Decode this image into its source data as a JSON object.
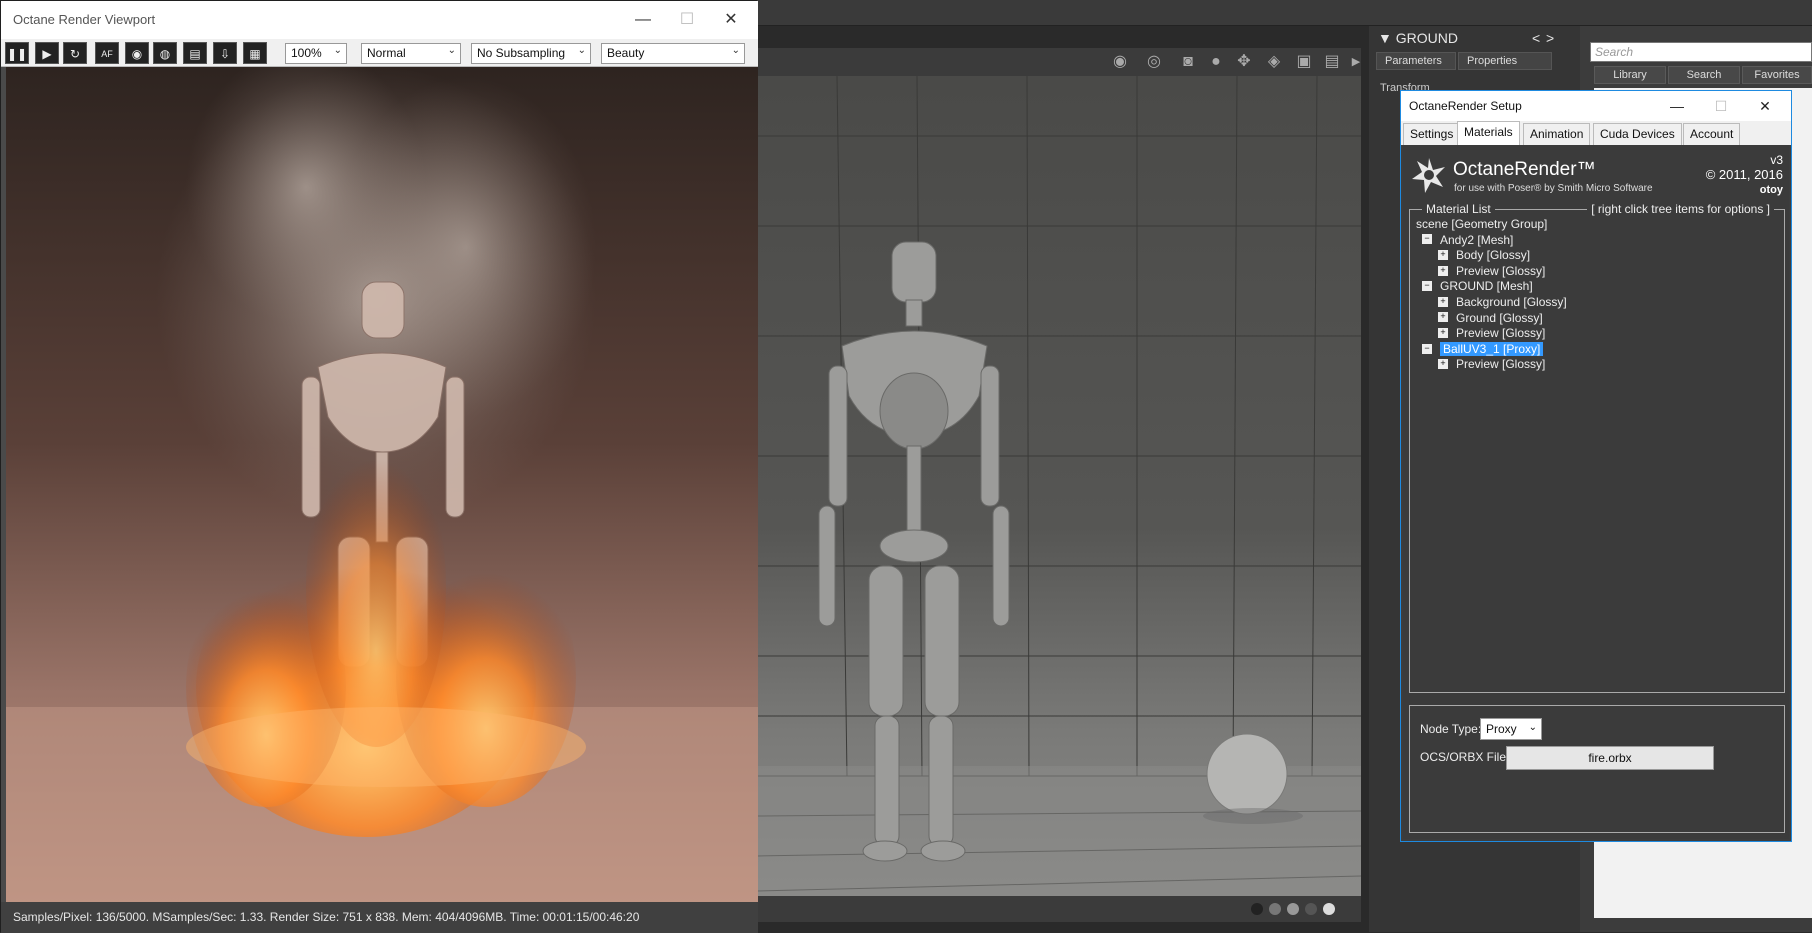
{
  "host": {
    "object_name": "GROUND",
    "tabs": [
      "Parameters",
      "Properties"
    ],
    "transform_label": "Transform",
    "search_placeholder": "Search",
    "library_tabs": [
      "Library",
      "Search",
      "Favorites"
    ]
  },
  "render_viewport": {
    "title": "Octane Render Viewport",
    "toolbar": {
      "zoom": "100%",
      "mode": "Normal",
      "subsampling": "No Subsampling",
      "pass": "Beauty"
    },
    "status": "Samples/Pixel: 136/5000. MSamples/Sec: 1.33. Render Size: 751 x 838. Mem: 404/4096MB. Time: 00:01:15/00:46:20"
  },
  "setup_dialog": {
    "title": "OctaneRender Setup",
    "tabs": [
      "Settings",
      "Materials",
      "Animation",
      "Cuda Devices",
      "Account"
    ],
    "active_tab": "Materials",
    "brand": {
      "name": "OctaneRender™",
      "subtitle": "for use with Poser® by Smith Micro Software",
      "version": "v3",
      "copyright": "© 2011, 2016",
      "otoy": "otoy"
    },
    "material_list": {
      "title": "Material List",
      "hint": "[ right click tree items for options ]",
      "items": [
        {
          "label": "scene   [Geometry Group]",
          "level": 0,
          "toggle": ""
        },
        {
          "label": "Andy2   [Mesh]",
          "level": 1,
          "toggle": "−"
        },
        {
          "label": "Body   [Glossy]",
          "level": 2,
          "toggle": "+"
        },
        {
          "label": "Preview   [Glossy]",
          "level": 2,
          "toggle": "+"
        },
        {
          "label": "GROUND   [Mesh]",
          "level": 1,
          "toggle": "−"
        },
        {
          "label": "Background   [Glossy]",
          "level": 2,
          "toggle": "+"
        },
        {
          "label": "Ground   [Glossy]",
          "level": 2,
          "toggle": "+"
        },
        {
          "label": "Preview   [Glossy]",
          "level": 2,
          "toggle": "+"
        },
        {
          "label": "BallUV3_1   [Proxy]",
          "level": 1,
          "toggle": "−",
          "selected": true
        },
        {
          "label": "Preview   [Glossy]",
          "level": 2,
          "toggle": "+"
        }
      ]
    },
    "node": {
      "type_label": "Node Type:",
      "type_value": "Proxy",
      "file_label": "OCS/ORBX File:",
      "file_value": "fire.orbx"
    }
  },
  "colors": {
    "selection": "#3399ff",
    "dialog_border": "#1e8ae0",
    "fire": "#ff8a2a"
  }
}
